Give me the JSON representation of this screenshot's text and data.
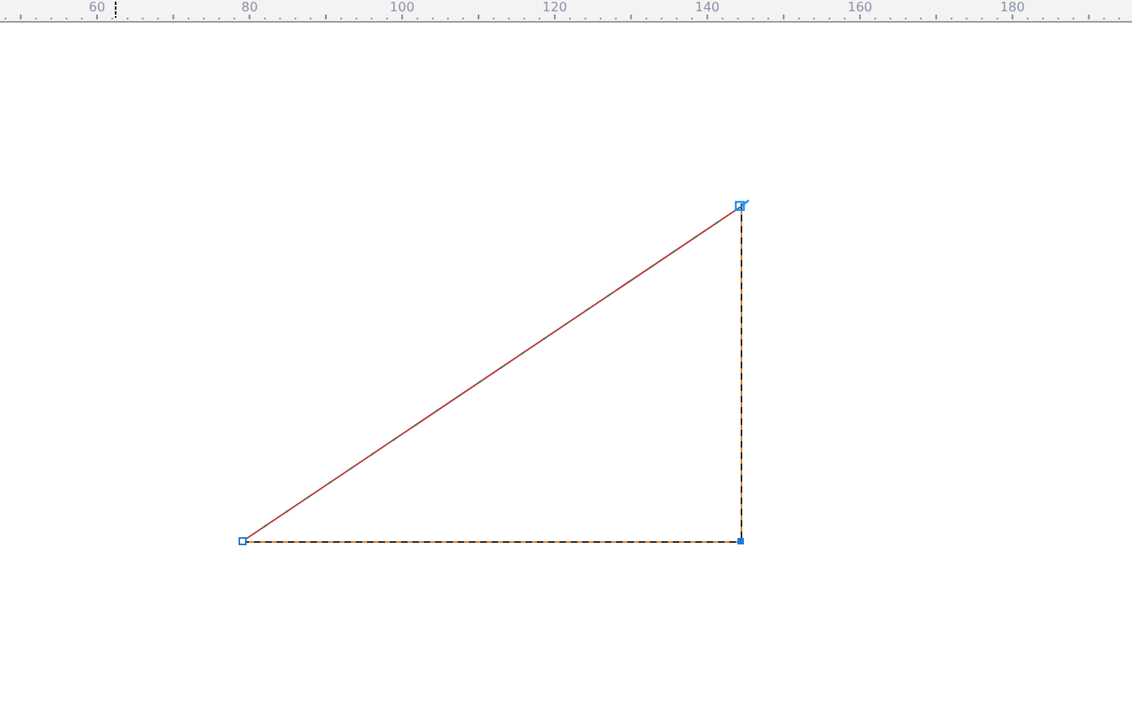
{
  "ruler": {
    "labels": [
      "60",
      "80",
      "100",
      "120",
      "140",
      "160",
      "180"
    ]
  }
}
